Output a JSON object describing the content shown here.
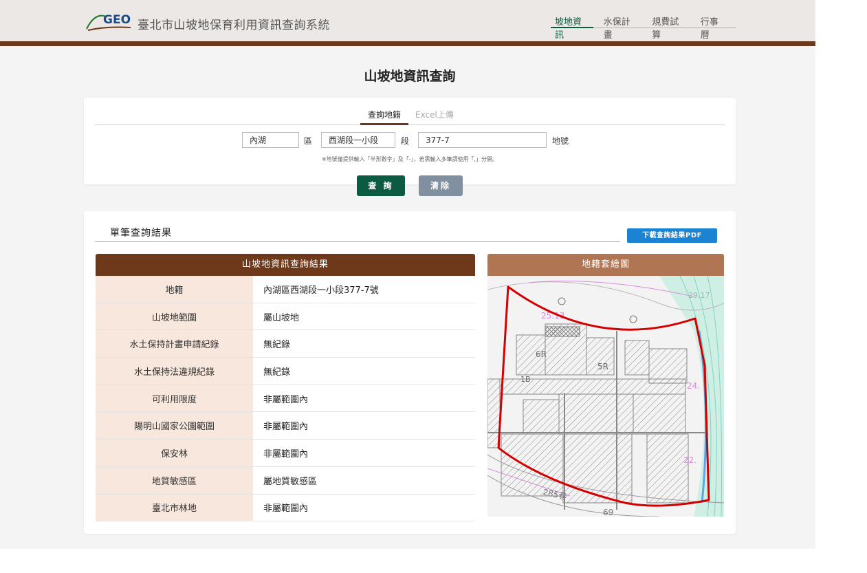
{
  "header": {
    "logo_text": "GEO",
    "site_title": "臺北市山坡地保育利用資訊查詢系統",
    "nav": [
      {
        "label": "坡地資訊",
        "active": true
      },
      {
        "label": "水保計畫",
        "active": false
      },
      {
        "label": "規費試算",
        "active": false
      },
      {
        "label": "行事曆",
        "active": false
      }
    ]
  },
  "page_title": "山坡地資訊查詢",
  "query": {
    "tabs": {
      "active": "查詢地籍",
      "inactive": "Excel上傳"
    },
    "district_value": "內湖",
    "district_label": "區",
    "section_value": "西湖段一小段",
    "section_label": "段",
    "lot_value": "377-7",
    "lot_label": "地號",
    "hint": "※地號僅提供輸入「半形數字」及「-」，若需輸入多筆請使用「,」分開。",
    "search_button": "查 詢",
    "clear_button": "清除"
  },
  "result": {
    "heading": "單筆查詢結果",
    "pdf_button": "下載查詢結果PDF",
    "table_title": "山坡地資訊查詢結果",
    "rows": [
      {
        "key": "地籍",
        "value": "內湖區西湖段一小段377-7號"
      },
      {
        "key": "山坡地範圍",
        "value": "屬山坡地"
      },
      {
        "key": "水土保持計畫申請紀錄",
        "value": "無紀錄"
      },
      {
        "key": "水土保持法違規紀錄",
        "value": "無紀錄"
      },
      {
        "key": "可利用限度",
        "value": "非屬範圍內"
      },
      {
        "key": "陽明山國家公園範圍",
        "value": "非屬範圍內"
      },
      {
        "key": "保安林",
        "value": "非屬範圍內"
      },
      {
        "key": "地質敏感區",
        "value": "屬地質敏感區"
      },
      {
        "key": "臺北市林地",
        "value": "非屬範圍內"
      }
    ],
    "map_title": "地籍套繪圖",
    "map_labels": [
      "25.13",
      "24.",
      "22.",
      "29.17",
      "6R",
      "5R",
      "1B",
      "285巷",
      "69"
    ]
  },
  "colors": {
    "brand_brown": "#6b3a1c",
    "brand_green": "#0d5a43",
    "pdf_blue": "#1c82d2",
    "parcel_red": "#d40000"
  }
}
